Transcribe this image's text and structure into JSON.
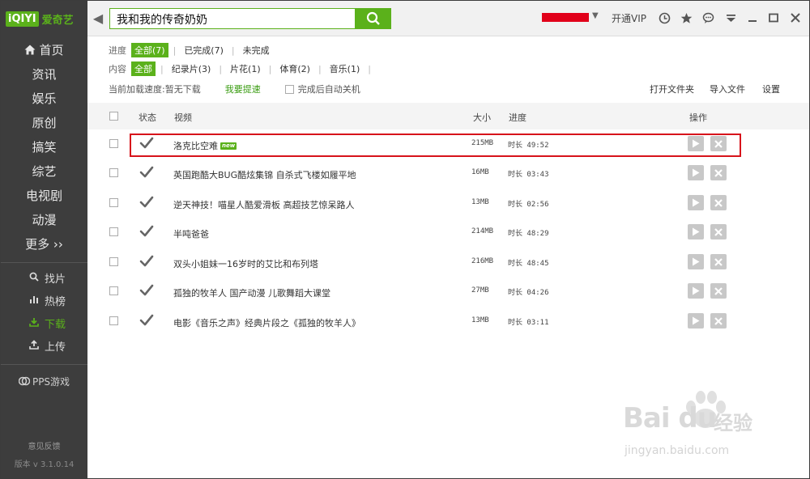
{
  "app": {
    "logo_mark": "iQIYI",
    "logo_text": "爱奇艺",
    "back_glyph": "◀",
    "search_value": "我和我的传奇奶奶",
    "user_caret": "▼",
    "vip_label": "开通VIP",
    "icons": [
      "clock-icon",
      "star-icon",
      "chat-icon",
      "menu-icon",
      "minimize-icon",
      "maximize-icon",
      "close-icon"
    ]
  },
  "sidebar": {
    "home": "首页",
    "channels": [
      "资讯",
      "娱乐",
      "原创",
      "搞笑",
      "综艺",
      "电视剧",
      "动漫",
      "更多 ››"
    ],
    "tools": [
      {
        "label": "找片",
        "icon": "search-icon",
        "glyph": "🔍"
      },
      {
        "label": "热榜",
        "icon": "bar-chart-icon",
        "glyph": "📊"
      },
      {
        "label": "下载",
        "icon": "download-icon",
        "glyph": "⬇",
        "active": true
      },
      {
        "label": "上传",
        "icon": "upload-icon",
        "glyph": "⬆"
      }
    ],
    "pps": "PPS游戏",
    "feedback": "意见反馈",
    "version": "版本 v 3.1.0.14"
  },
  "filters": {
    "progress_label": "进度",
    "progress": [
      {
        "label": "全部(7)",
        "active": true
      },
      {
        "label": "已完成(7)"
      },
      {
        "label": "未完成"
      }
    ],
    "content_label": "内容",
    "content": [
      {
        "label": "全部",
        "active": true
      },
      {
        "label": "纪录片(3)"
      },
      {
        "label": "片花(1)"
      },
      {
        "label": "体育(2)"
      },
      {
        "label": "音乐(1)"
      }
    ],
    "speed_text": "当前加载速度:暂无下载",
    "speed_up": "我要提速",
    "auto_shutdown": "完成后自动关机",
    "open_folder": "打开文件夹",
    "import_file": "导入文件",
    "settings": "设置"
  },
  "table": {
    "headers": {
      "status": "状态",
      "video": "视频",
      "size": "大小",
      "progress": "进度",
      "action": "操作"
    },
    "rows": [
      {
        "title": "洛克比空难",
        "new": "new",
        "size": "215MB",
        "duration": "时长 49:52"
      },
      {
        "title": "英国跑酷大BUG酷炫集锦 自杀式飞楼如履平地",
        "size": "16MB",
        "duration": "时长 03:43"
      },
      {
        "title": "逆天神技！喵星人酷爱滑板 高超技艺惊呆路人",
        "size": "13MB",
        "duration": "时长 02:56"
      },
      {
        "title": "半吨爸爸",
        "size": "214MB",
        "duration": "时长 48:29"
      },
      {
        "title": "双头小姐妹一16岁时的艾比和布列塔",
        "size": "216MB",
        "duration": "时长 48:45"
      },
      {
        "title": "孤独的牧羊人 国产动漫 儿歌舞蹈大课堂",
        "size": "27MB",
        "duration": "时长 04:26"
      },
      {
        "title": "电影《音乐之声》经典片段之《孤独的牧羊人》",
        "size": "13MB",
        "duration": "时长 03:11"
      }
    ]
  },
  "watermark": {
    "brand": "Bai du",
    "cn": "经验",
    "url": "jingyan.baidu.com"
  },
  "colors": {
    "accent": "#5bb11b",
    "sidebar": "#3d3d3d",
    "highlight": "#d7131b"
  }
}
